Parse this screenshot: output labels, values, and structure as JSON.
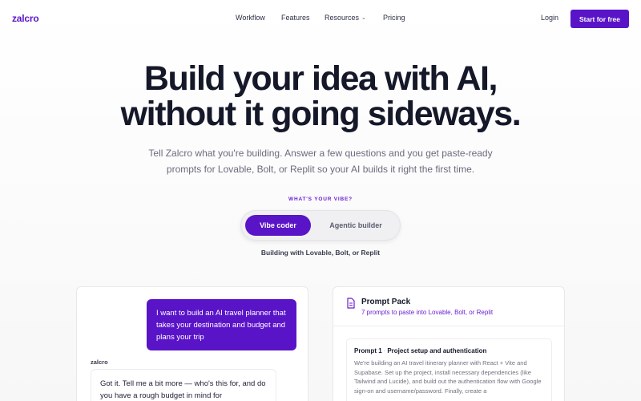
{
  "nav": {
    "logo": "zalcro",
    "links": [
      "Workflow",
      "Features",
      "Resources",
      "Pricing"
    ],
    "login": "Login",
    "cta": "Start for free"
  },
  "hero": {
    "headline_line1": "Build your idea with AI,",
    "headline_line2": "without it going sideways.",
    "sub_line1": "Tell Zalcro what you're building. Answer a few questions and you get paste-ready",
    "sub_line2": "prompts for Lovable, Bolt, or Replit so your AI builds it right the first time."
  },
  "vibe": {
    "label": "WHAT'S YOUR VIBE?",
    "options": [
      "Vibe coder",
      "Agentic builder"
    ],
    "selected": "Vibe coder",
    "caption": "Building with Lovable, Bolt, or Replit"
  },
  "chat": {
    "user_message": "I want to build an AI travel planner that takes your destination and budget and plans your trip",
    "bot_name": "zalcro",
    "bot_message": "Got it. Tell me a bit more — who's this for, and do you have a rough budget in mind for"
  },
  "prompt_pack": {
    "title": "Prompt Pack",
    "subtitle": "7 prompts to paste into Lovable, Bolt, or Replit",
    "prompt_number": "Prompt 1",
    "prompt_sep": "·",
    "prompt_title": "Project setup and authentication",
    "prompt_body": "We're building an AI travel itinerary planner with React + Vite and Supabase. Set up the project, install necessary dependencies (like Tailwind and Lucide), and build out the authentication flow with Google sign-on and username/password. Finally, create a"
  },
  "colors": {
    "accent": "#5a14c8",
    "accent_text": "#6b1fd1",
    "headline": "#151829",
    "muted": "#6a6c7c"
  },
  "icons": {
    "resources_chevron": "chevron-down-icon",
    "prompt_pack": "document-icon"
  }
}
